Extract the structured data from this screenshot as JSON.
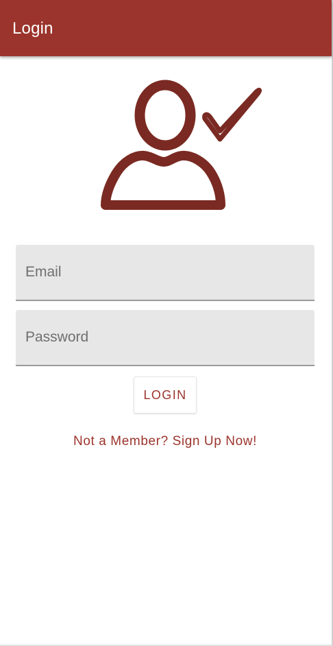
{
  "app_bar": {
    "title": "Login",
    "color": "#9b342c"
  },
  "illustration": {
    "icon": "user-check-icon",
    "color": "#7a2a22"
  },
  "form": {
    "email_placeholder": "Email",
    "password_placeholder": "Password",
    "login_label": "LOGIN"
  },
  "signup": {
    "text": "Not a Member? Sign Up Now!"
  }
}
